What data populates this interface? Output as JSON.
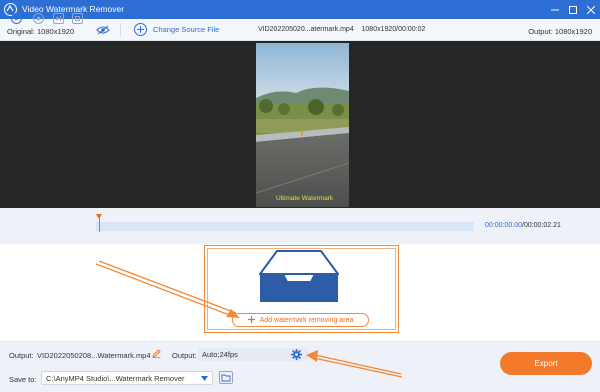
{
  "window": {
    "title": "Video Watermark Remover"
  },
  "topbar": {
    "original_label": "Original: 1080x1920",
    "change_source_label": "Change Source File",
    "file_name": "VID202205020...atermark.mp4",
    "file_meta": "1080x1920/00:00:02",
    "output_label": "Output: 1080x1920"
  },
  "preview": {
    "watermark_text": "Ultimate  Watermark"
  },
  "controls": {
    "current_time": "00:00:00.00",
    "separator": "/",
    "duration": "00:00:02.21",
    "playhead_fraction": 0.0
  },
  "add_area": {
    "button_label": "Add watermark removing area"
  },
  "bottom": {
    "output_label": "Output:",
    "output_file": "VID2022050208...Watermark.mp4",
    "output_format_label": "Output:",
    "output_format_value": "Auto;24fps",
    "save_to_label": "Save to:",
    "save_to_path": "C:\\AnyMP4 Studio\\...Watermark Remover",
    "export_label": "Export"
  },
  "colors": {
    "brand_blue": "#2d6ed4",
    "accent_orange": "#f47a2b",
    "preview_bg": "#262626"
  },
  "icons": [
    "app-logo-icon",
    "minimize-icon",
    "maximize-icon",
    "close-icon",
    "eye-slash-icon",
    "plus-circle-icon",
    "play-icon",
    "stop-icon",
    "next-frame-icon",
    "clip-icon",
    "tray-icon",
    "plus-icon",
    "edit-pencil-icon",
    "gear-icon",
    "chevron-down-icon",
    "folder-icon"
  ]
}
